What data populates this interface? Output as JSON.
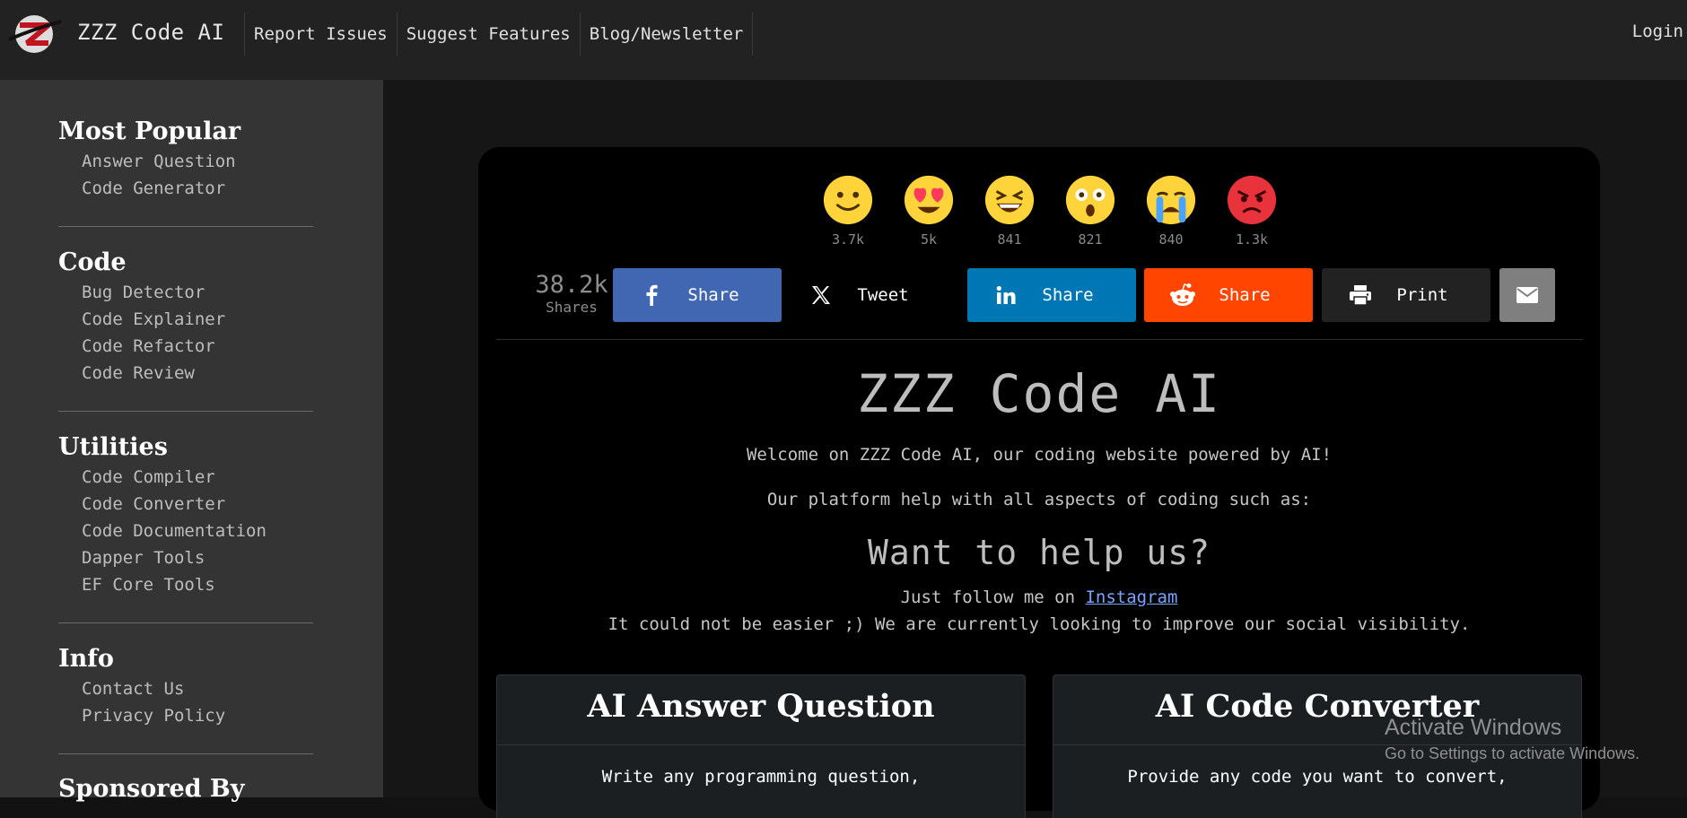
{
  "header": {
    "brand": "ZZZ Code AI",
    "nav": [
      "Report Issues",
      "Suggest Features",
      "Blog/Newsletter"
    ],
    "login": "Login"
  },
  "sidebar": {
    "sections": [
      {
        "title": "Most Popular",
        "items": [
          "Answer Question",
          "Code Generator"
        ]
      },
      {
        "title": "Code",
        "items": [
          "Bug Detector",
          "Code Explainer",
          "Code Refactor",
          "Code Review"
        ]
      },
      {
        "title": "Utilities",
        "items": [
          "Code Compiler",
          "Code Converter",
          "Code Documentation",
          "Dapper Tools",
          "EF Core Tools"
        ]
      },
      {
        "title": "Info",
        "items": [
          "Contact Us",
          "Privacy Policy"
        ]
      },
      {
        "title": "Sponsored By",
        "items": []
      }
    ]
  },
  "reactions": [
    {
      "icon": "smile-emoji-icon",
      "count": "3.7k"
    },
    {
      "icon": "heart-eyes-emoji-icon",
      "count": "5k"
    },
    {
      "icon": "laughing-emoji-icon",
      "count": "841"
    },
    {
      "icon": "astonished-emoji-icon",
      "count": "821"
    },
    {
      "icon": "crying-emoji-icon",
      "count": "840"
    },
    {
      "icon": "angry-emoji-icon",
      "count": "1.3k"
    }
  ],
  "share": {
    "total": "38.2k",
    "total_label": "Shares",
    "buttons": [
      {
        "name": "facebook",
        "label": "Share",
        "color": "#4267b2"
      },
      {
        "name": "x",
        "label": "Tweet",
        "color": "#000000"
      },
      {
        "name": "linkedin",
        "label": "Share",
        "color": "#0077b5"
      },
      {
        "name": "reddit",
        "label": "Share",
        "color": "#ff4500"
      },
      {
        "name": "print",
        "label": "Print",
        "color": "#222222"
      },
      {
        "name": "email",
        "label": "",
        "color": "#7f7f7f"
      }
    ]
  },
  "hero": {
    "title": "ZZZ Code AI",
    "welcome": "Welcome on ZZZ Code AI, our coding website powered by AI!",
    "platform": "Our platform help with all aspects of coding such as:"
  },
  "help": {
    "title": "Want to help us?",
    "follow_prefix": "Just follow me on ",
    "follow_link": "Instagram",
    "line2": "It could not be easier ;) We are currently looking to improve our social visibility."
  },
  "features": [
    {
      "title": "AI Answer Question",
      "desc": "Write any programming question,"
    },
    {
      "title": "AI Code Converter",
      "desc": "Provide any code you want to convert,"
    }
  ],
  "watermark": {
    "line1": "Activate Windows",
    "line2": "Go to Settings to activate Windows."
  }
}
